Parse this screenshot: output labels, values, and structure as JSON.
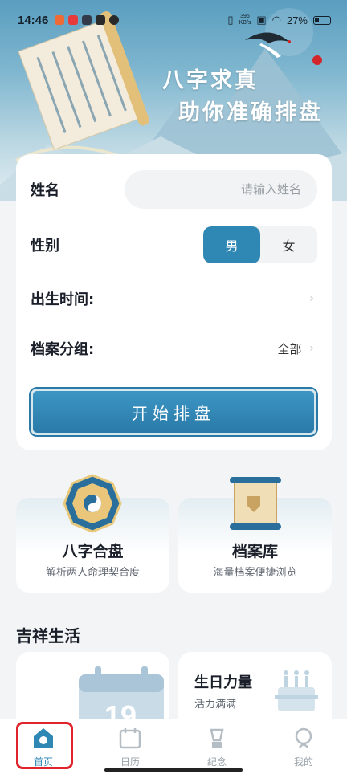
{
  "status_bar": {
    "time": "14:46",
    "net_speed_value": "396",
    "net_speed_unit": "KB/s",
    "battery": "27%",
    "app_icon_colors": [
      "#f06a35",
      "#e83a3a",
      "#333a4a",
      "#2a2a2a",
      "#2a2a2a"
    ]
  },
  "banner": {
    "line1": "八字求真",
    "line2": "助你准确排盘"
  },
  "form": {
    "name_label": "姓名",
    "name_placeholder": "请输入姓名",
    "name_value": "",
    "gender_label": "性别",
    "gender_options": [
      "男",
      "女"
    ],
    "gender_selected": "男",
    "birth_label": "出生时间:",
    "birth_value": "",
    "group_label": "档案分组:",
    "group_value": "全部",
    "start_button": "开始排盘"
  },
  "features": [
    {
      "title": "八字合盘",
      "subtitle": "解析两人命理契合度",
      "icon": "bagua-icon"
    },
    {
      "title": "档案库",
      "subtitle": "海量档案便捷浏览",
      "icon": "scroll-icon"
    }
  ],
  "section": {
    "title": "吉祥生活"
  },
  "life_cards": [
    {
      "title": "",
      "subtitle": "",
      "icon": "calendar-icon",
      "calendar_day": "19"
    },
    {
      "title": "生日力量",
      "subtitle": "活力满满",
      "icon": "cake-icon"
    }
  ],
  "tabs": [
    {
      "label": "首页",
      "icon": "home-icon",
      "active": true
    },
    {
      "label": "日历",
      "icon": "calendar-icon",
      "active": false
    },
    {
      "label": "纪念",
      "icon": "memorial-icon",
      "active": false
    },
    {
      "label": "我的",
      "icon": "profile-icon",
      "active": false
    }
  ],
  "colors": {
    "accent": "#2f87b4",
    "highlight": "#e0242b"
  }
}
